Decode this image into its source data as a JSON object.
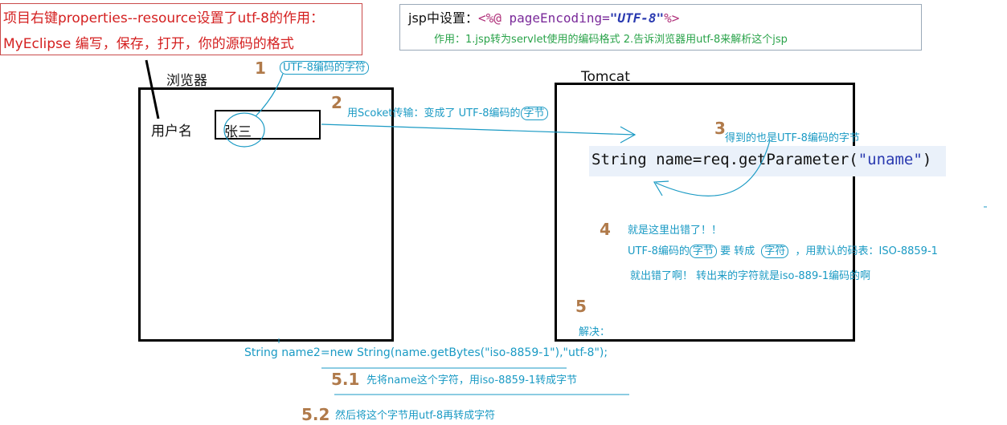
{
  "top_left_note": {
    "line1": "项目右键properties--resource设置了utf-8的作用：",
    "line2": "MyEclipse 编写，保存，打开，你的源码的格式"
  },
  "jsp_note": {
    "prefix": "jsp中设置：",
    "open_tag": "<%@",
    "attr": " pageEncoding=",
    "value": "\"UTF-8\"",
    "close_tag": "%>",
    "usage": "作用：1.jsp转为servlet使用的编码格式  2.告诉浏览器用utf-8来解析这个jsp"
  },
  "browser": {
    "title": "浏览器",
    "field_label": "用户名",
    "field_value": "张三"
  },
  "tomcat": {
    "title": "Tomcat",
    "code_prefix": "String name=req.getParameter(",
    "code_arg": "\"uname\"",
    "code_suffix": ")"
  },
  "steps": {
    "s1": {
      "num": "1",
      "text": "UTF-8编码的字符"
    },
    "s2": {
      "num": "2",
      "text_pre": "用Scoket传输：变成了 UTF-8编码的",
      "text_pill": "字节"
    },
    "s3": {
      "num": "3",
      "text": "得到的也是UTF-8编码的字节"
    },
    "s4": {
      "num": "4",
      "line1": "就是这里出错了！！",
      "line2_a": "UTF-8编码的",
      "line2_pill1": "字节",
      "line2_b": "要 转成",
      "line2_pill2": "字符",
      "line2_c": "，用默认的码表：ISO-8859-1",
      "line3": "就出错了啊！ 转出来的字符就是iso-889-1编码的啊"
    },
    "s5": {
      "num": "5",
      "text": "解决："
    },
    "code_fix": "String name2=new String(name.getBytes(\"iso-8859-1\"),\"utf-8\");",
    "s51": {
      "num": "5.1",
      "text": "先将name这个字符，用iso-8859-1转成字节"
    },
    "s52": {
      "num": "5.2",
      "text": "然后将这个字节用utf-8再转成字符"
    }
  }
}
